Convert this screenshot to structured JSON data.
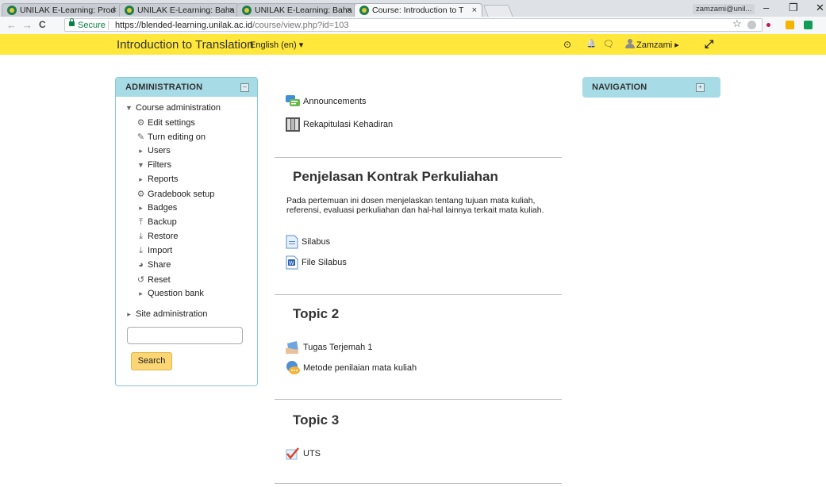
{
  "browser": {
    "tabs": [
      {
        "title": "UNILAK E-Learning: Prod",
        "active": false
      },
      {
        "title": "UNILAK E-Learning: Baha",
        "active": false
      },
      {
        "title": "UNILAK E-Learning: Baha",
        "active": false
      },
      {
        "title": "Course: Introduction to T",
        "active": true
      }
    ],
    "tab_close": "×",
    "profile": "zamzami@unil...",
    "window_minimize": "–",
    "window_restore": "❐",
    "window_close": "✕",
    "back": "←",
    "forward": "→",
    "reload": "C",
    "secure_label": "Secure",
    "url_base": "https://blended-learning.unilak.ac.id",
    "url_path": "/course/view.php?id=103",
    "bookmark_star": "☆",
    "extension_colors": [
      "#c5c8cc",
      "#c2185b",
      "#f4b400",
      "#0f9d58"
    ]
  },
  "header": {
    "site_title": "Introduction to Translation",
    "language": "English (en) ▾",
    "notification_icon": "⊙",
    "bell_icon": "🔔",
    "message_icon": "🗨",
    "user_name": "Zamzami ▸",
    "expand_icon": "⤢"
  },
  "administration": {
    "title": "ADMINISTRATION",
    "collapse_symbol": "–",
    "course_admin_label": "Course administration",
    "items": [
      {
        "label": "Edit settings",
        "icon": "gear-icon",
        "glyph": "⚙"
      },
      {
        "label": "Turn editing on",
        "icon": "pencil-icon",
        "glyph": "✎"
      },
      {
        "label": "Users",
        "icon": "caret-right-icon",
        "glyph": "▸"
      },
      {
        "label": "Filters",
        "icon": "filter-icon",
        "glyph": "▼"
      },
      {
        "label": "Reports",
        "icon": "caret-right-icon",
        "glyph": "▸"
      },
      {
        "label": "Gradebook setup",
        "icon": "gear-icon",
        "glyph": "⚙"
      },
      {
        "label": "Badges",
        "icon": "caret-right-icon",
        "glyph": "▸"
      },
      {
        "label": "Backup",
        "icon": "upload-icon",
        "glyph": "⤒"
      },
      {
        "label": "Restore",
        "icon": "download-icon",
        "glyph": "⤓"
      },
      {
        "label": "Import",
        "icon": "download-icon",
        "glyph": "⤓"
      },
      {
        "label": "Share",
        "icon": "share-icon",
        "glyph": "◕"
      },
      {
        "label": "Reset",
        "icon": "reset-icon",
        "glyph": "↺"
      },
      {
        "label": "Question bank",
        "icon": "caret-right-icon",
        "glyph": "▸"
      }
    ],
    "site_admin_label": "Site administration",
    "search_placeholder": "",
    "search_button": "Search"
  },
  "navigation": {
    "title": "NAVIGATION",
    "dock_symbol": "+"
  },
  "content": {
    "top_links": [
      {
        "label": "Announcements",
        "icon": "forum-icon"
      },
      {
        "label": "Rekapitulasi Kehadiran",
        "icon": "attendance-icon"
      }
    ],
    "sections": [
      {
        "title": "Penjelasan Kontrak Perkuliahan",
        "summary": "Pada pertemuan ini dosen menjelaskan tentang tujuan mata kuliah, referensi, evaluasi perkuliahan dan hal-hal lainnya terkait mata kuliah.",
        "activities": [
          {
            "label": "Silabus",
            "icon": "file-icon"
          },
          {
            "label": "File Silabus",
            "icon": "word-doc-icon"
          }
        ]
      },
      {
        "title": "Topic 2",
        "activities": [
          {
            "label": "Tugas Terjemah 1",
            "icon": "assignment-icon"
          },
          {
            "label": "Metode penilaian mata kuliah",
            "icon": "chat-icon"
          }
        ]
      },
      {
        "title": "Topic 3",
        "activities": [
          {
            "label": "UTS",
            "icon": "quiz-icon"
          }
        ]
      }
    ]
  }
}
